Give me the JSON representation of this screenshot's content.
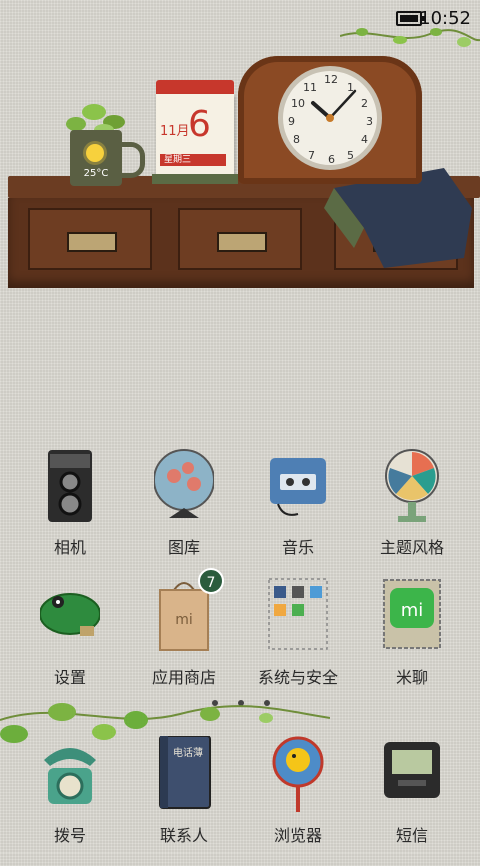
{
  "status_bar": {
    "time": "10:52",
    "battery_icon": "battery-icon"
  },
  "widget": {
    "temperature": "25°C",
    "calendar": {
      "month": "11月",
      "day": "6",
      "weekday": "星期三"
    },
    "clock_numbers": [
      "12",
      "1",
      "2",
      "3",
      "4",
      "5",
      "6",
      "7",
      "8",
      "9",
      "10",
      "11"
    ]
  },
  "apps": [
    {
      "label": "相机",
      "icon": "camera-icon"
    },
    {
      "label": "图库",
      "icon": "gallery-icon"
    },
    {
      "label": "音乐",
      "icon": "music-player-icon"
    },
    {
      "label": "主题风格",
      "icon": "fan-theme-icon"
    },
    {
      "label": "设置",
      "icon": "settings-frog-icon"
    },
    {
      "label": "应用商店",
      "icon": "shopping-bag-icon",
      "badge": "7"
    },
    {
      "label": "系统与安全",
      "icon": "security-folder-icon"
    },
    {
      "label": "米聊",
      "icon": "mi-stamp-icon"
    }
  ],
  "dock": [
    {
      "label": "拨号",
      "icon": "rotary-phone-icon"
    },
    {
      "label": "联系人",
      "icon": "address-book-icon"
    },
    {
      "label": "浏览器",
      "icon": "duck-drum-icon"
    },
    {
      "label": "短信",
      "icon": "pager-icon"
    }
  ],
  "address_book_text": "电话薄",
  "mi_logo_text": "mi",
  "colors": {
    "accent_red": "#c7372c",
    "wood": "#6b3c22",
    "badge_green": "#2b5c3d",
    "leaf_green": "#6cae3c"
  }
}
